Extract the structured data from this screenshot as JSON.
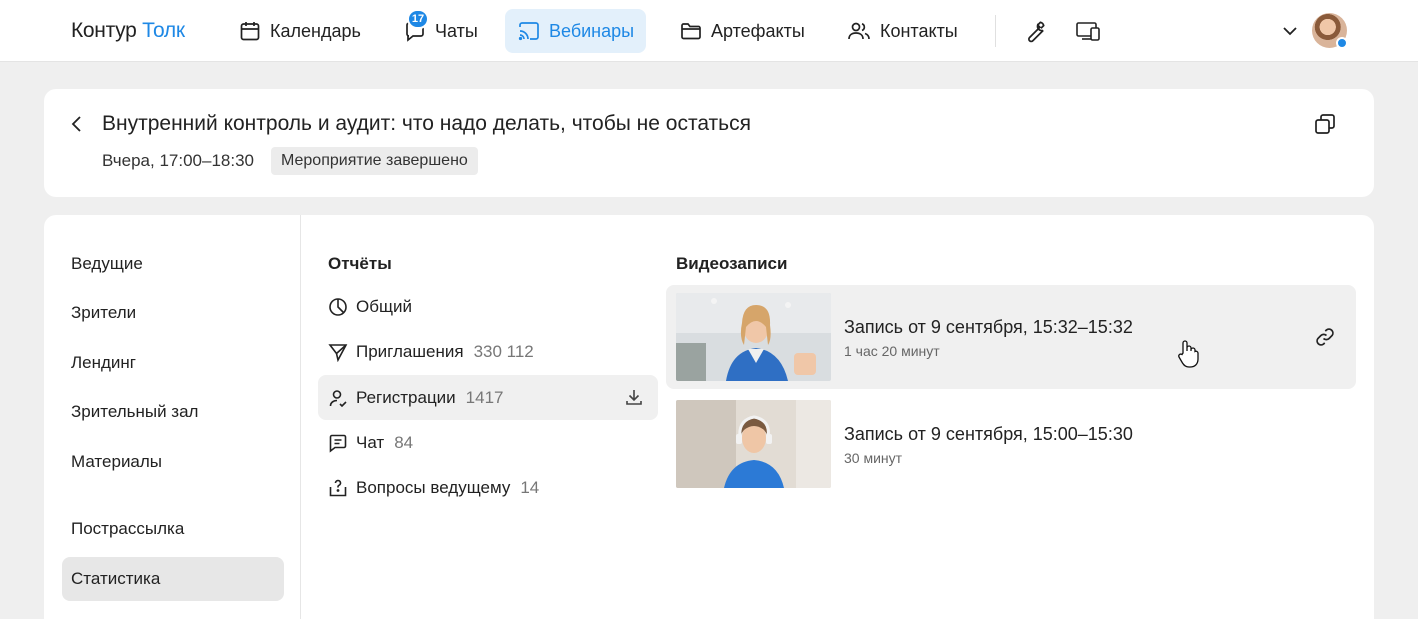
{
  "app": {
    "logo_part1": "Контур",
    "logo_part2": "Толк",
    "accent": "#1e88e5"
  },
  "nav": {
    "items": [
      {
        "label": "Календарь",
        "icon": "calendar-icon"
      },
      {
        "label": "Чаты",
        "icon": "chat-icon",
        "badge": "17"
      },
      {
        "label": "Вебинары",
        "icon": "cast-icon",
        "active": true
      },
      {
        "label": "Артефакты",
        "icon": "folder-icon"
      },
      {
        "label": "Контакты",
        "icon": "people-icon"
      }
    ],
    "tools_icon": "wrench-icon",
    "devices_icon": "devices-icon",
    "account_icon": "chevron-down-icon"
  },
  "event": {
    "title": "Внутренний контроль и аудит: что надо делать, чтобы не остаться",
    "time": "Вчера, 17:00–18:30",
    "status": "Мероприятие завершено"
  },
  "sidebar": {
    "items": [
      {
        "label": "Ведущие"
      },
      {
        "label": "Зрители"
      },
      {
        "label": "Лендинг"
      },
      {
        "label": "Зрительный зал"
      },
      {
        "label": "Материалы"
      },
      {
        "label": "Пострассылка"
      },
      {
        "label": "Статистика",
        "active": true
      }
    ]
  },
  "reports": {
    "title": "Отчёты",
    "items": [
      {
        "label": "Общий",
        "count": "",
        "icon": "pie-chart-icon"
      },
      {
        "label": "Приглашения",
        "count": "330 112",
        "icon": "send-icon"
      },
      {
        "label": "Регистрации",
        "count": "1417",
        "icon": "user-check-icon",
        "active": true
      },
      {
        "label": "Чат",
        "count": "84",
        "icon": "message-icon"
      },
      {
        "label": "Вопросы ведущему",
        "count": "14",
        "icon": "question-icon"
      }
    ]
  },
  "recordings": {
    "title": "Видеозаписи",
    "items": [
      {
        "title": "Запись от 9 сентября, 15:32–15:32",
        "duration": "1 час 20 минут"
      },
      {
        "title": "Запись от 9 сентября, 15:00–15:30",
        "duration": "30 минут"
      }
    ]
  }
}
